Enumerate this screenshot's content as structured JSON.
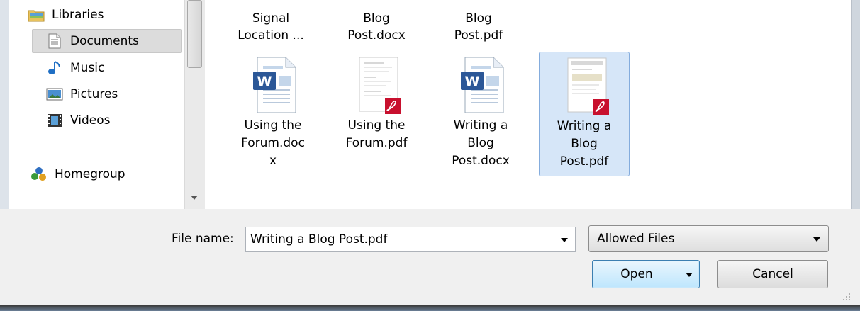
{
  "nav": {
    "items": [
      {
        "label": "Libraries",
        "icon": "libraries-icon"
      },
      {
        "label": "Documents",
        "icon": "documents-icon",
        "selected": true
      },
      {
        "label": "Music",
        "icon": "music-icon"
      },
      {
        "label": "Pictures",
        "icon": "pictures-icon"
      },
      {
        "label": "Videos",
        "icon": "videos-icon"
      },
      {
        "label": "Homegroup",
        "icon": "homegroup-icon"
      }
    ]
  },
  "files": {
    "top_row_partial": [
      {
        "lines": [
          "Signal",
          "Location ..."
        ]
      },
      {
        "lines": [
          "Blog",
          "Post.docx"
        ]
      },
      {
        "lines": [
          "Blog",
          "Post.pdf"
        ]
      }
    ],
    "items": [
      {
        "lines": [
          "Using the",
          "Forum.doc",
          "x"
        ],
        "type": "word",
        "icon": "word-document-icon"
      },
      {
        "lines": [
          "Using the",
          "Forum.pdf"
        ],
        "type": "pdf",
        "icon": "pdf-document-icon"
      },
      {
        "lines": [
          "Writing a",
          "Blog",
          "Post.docx"
        ],
        "type": "word",
        "icon": "word-document-icon"
      },
      {
        "lines": [
          "Writing a",
          "Blog",
          "Post.pdf"
        ],
        "type": "pdf",
        "icon": "pdf-document-icon",
        "selected": true
      }
    ]
  },
  "bottom": {
    "file_name_label": "File name:",
    "file_name_value": "Writing a Blog Post.pdf",
    "filter_value": "Allowed Files",
    "open_label": "Open",
    "cancel_label": "Cancel"
  },
  "colors": {
    "selection_bg": "#d6e6f8",
    "selection_border": "#84acdd",
    "pdf_red": "#c8102e",
    "word_blue": "#2b5797"
  }
}
